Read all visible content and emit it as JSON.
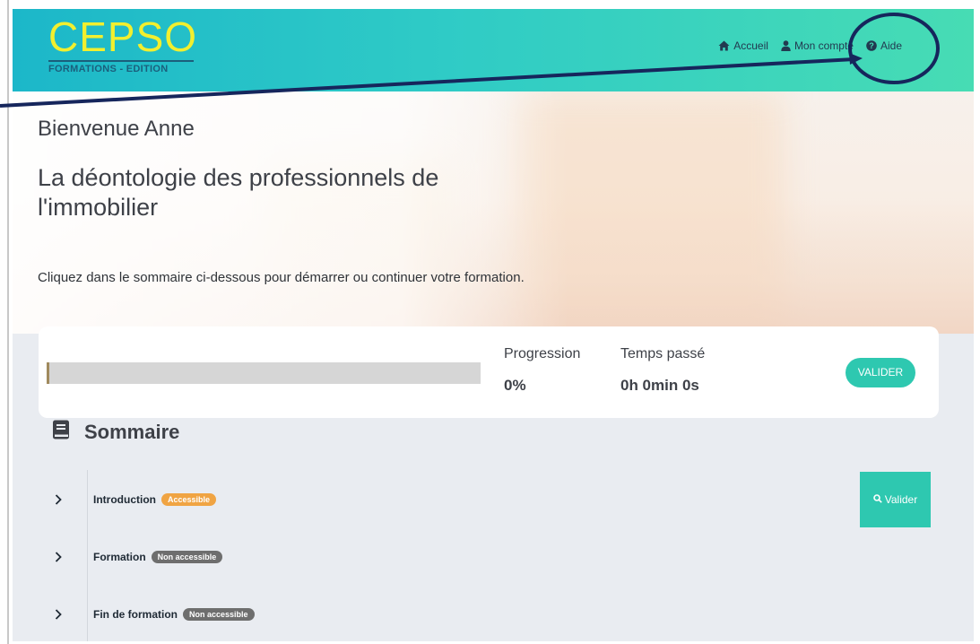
{
  "header": {
    "logo_text": "CEPSO",
    "logo_subtitle": "FORMATIONS - EDITION",
    "nav": [
      {
        "label": "Accueil",
        "icon": "home-icon"
      },
      {
        "label": "Mon compte",
        "icon": "user-icon"
      },
      {
        "label": "Aide",
        "icon": "question-circle-icon"
      }
    ]
  },
  "hero": {
    "welcome": "Bienvenue Anne",
    "course_title": "La déontologie des professionnels de l'immobilier",
    "instruction": "Cliquez dans le sommaire ci-dessous pour démarrer ou continuer votre formation."
  },
  "progress": {
    "percent_value": 0,
    "progression_label": "Progression",
    "progression_value": "0%",
    "time_label": "Temps passé",
    "time_value": "0h 0min 0s",
    "validate_label": "VALIDER"
  },
  "sommaire": {
    "title": "Sommaire",
    "icon": "book-icon",
    "items": [
      {
        "label": "Introduction",
        "badge": "Accessible",
        "badge_status": "accessible"
      },
      {
        "label": "Formation",
        "badge": "Non accessible",
        "badge_status": "locked"
      },
      {
        "label": "Fin de formation",
        "badge": "Non accessible",
        "badge_status": "locked"
      }
    ],
    "validate_button": "Valider",
    "validate_icon": "search-icon"
  },
  "colors": {
    "header_start": "#1cb7c9",
    "header_end": "#47dcb4",
    "logo_yellow": "#f2ef2e",
    "accent_teal": "#2ec8b0",
    "badge_accessible": "#f0a443",
    "badge_locked": "#6e6e6e",
    "annotation": "#16265c"
  }
}
